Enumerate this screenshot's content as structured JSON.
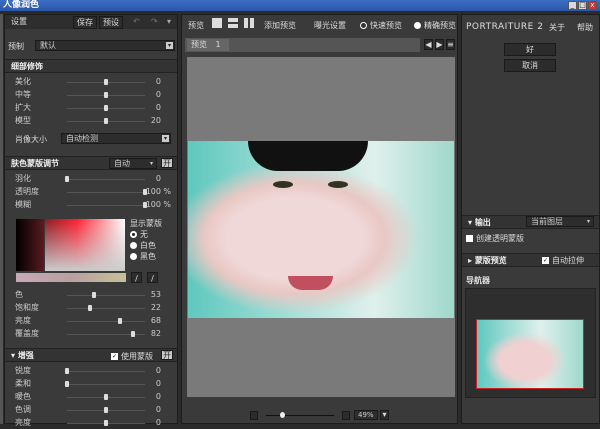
{
  "window": {
    "title": "人像润色",
    "min": "_",
    "max": "□",
    "close": "x"
  },
  "left": {
    "header": {
      "title": "设置",
      "save": "保存",
      "preset": "预设"
    },
    "preset_row": {
      "label": "预制",
      "value": "默认"
    },
    "detail": {
      "title": "细部修饰",
      "sliders": [
        {
          "label": "美化",
          "value": 0,
          "pos": 0.5
        },
        {
          "label": "中等",
          "value": 0,
          "pos": 0.5
        },
        {
          "label": "扩大",
          "value": 0,
          "pos": 0.5
        },
        {
          "label": "模型",
          "value": 20,
          "pos": 0.5
        }
      ],
      "size_label": "肖像大小",
      "size_value": "自动检测"
    },
    "skin": {
      "title": "肤色蒙版调节",
      "mode": "自动",
      "toggle": "开",
      "sliders": [
        {
          "label": "羽化",
          "value": 0,
          "pos": 0,
          "unit": ""
        },
        {
          "label": "透明度",
          "value": 100,
          "pos": 1,
          "unit": "%"
        },
        {
          "label": "模糊",
          "value": 100,
          "pos": 1,
          "unit": "%"
        }
      ],
      "show_mask": "显示蒙版",
      "mask_options": [
        {
          "label": "无",
          "selected": true
        },
        {
          "label": "白色",
          "selected": false
        },
        {
          "label": "黑色",
          "selected": false
        }
      ],
      "hsl": [
        {
          "label": "色",
          "value": 53,
          "pos": 0.35
        },
        {
          "label": "饱和度",
          "value": 22,
          "pos": 0.3
        },
        {
          "label": "亮度",
          "value": 68,
          "pos": 0.68
        },
        {
          "label": "覆盖度",
          "value": 82,
          "pos": 0.85
        }
      ]
    },
    "enhance": {
      "title": "增强",
      "use_mask": "使用蒙版",
      "use_mask_checked": true,
      "toggle": "开",
      "sliders": [
        {
          "label": "锐度",
          "value": 0,
          "pos": 0
        },
        {
          "label": "柔和",
          "value": 0,
          "pos": 0
        },
        {
          "label": "暖色",
          "value": 0,
          "pos": 0.5
        },
        {
          "label": "色调",
          "value": 0,
          "pos": 0.5
        },
        {
          "label": "亮度",
          "value": 0,
          "pos": 0.5
        }
      ]
    }
  },
  "center": {
    "toolbar": {
      "preview": "预览",
      "add_preview": "添加预览",
      "exposure": "曝光设置",
      "fast": "快速预览",
      "accurate": "精确预览"
    },
    "tab": {
      "label": "预览",
      "number": "1"
    },
    "zoom": {
      "value": "49%",
      "slider": 0.2
    },
    "nav": [
      "◀",
      "▶",
      "≡"
    ]
  },
  "right": {
    "brand": "PORTRAITURE 2",
    "about": "关于",
    "help": "帮助",
    "ok": "好",
    "cancel": "取消",
    "output": {
      "title": "输出",
      "value": "当前图层",
      "create_mask": "创建透明蒙版"
    },
    "mask_preview": {
      "title": "蒙版预览",
      "auto_pull": "自动拉伸",
      "checked": true
    },
    "navigator": {
      "title": "导航器"
    }
  }
}
